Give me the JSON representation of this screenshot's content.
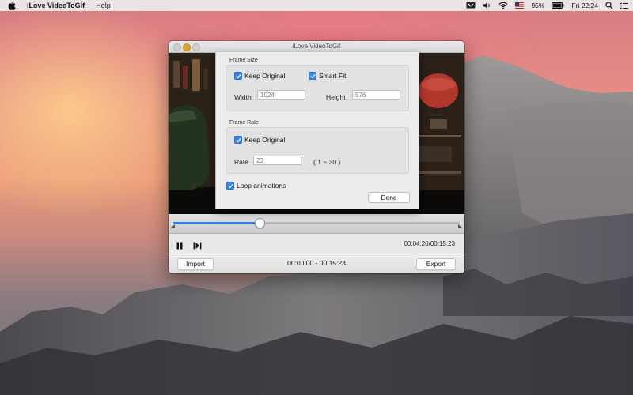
{
  "menubar": {
    "app_name": "iLove VideoToGif",
    "menu_help": "Help",
    "battery_percent": "95%",
    "clock": "Fri 22:24",
    "icons": [
      "apple-icon",
      "flag-icon",
      "volume-icon",
      "wifi-icon",
      "input-source-flag-icon",
      "battery-icon",
      "search-icon",
      "notification-center-icon"
    ]
  },
  "window": {
    "title": "iLove VideoToGif",
    "time_current_total": "00:04:20/00:15:23",
    "range": "00:00:00 - 00:15:23",
    "import_label": "Import",
    "export_label": "Export",
    "progress_fraction": 0.3,
    "accent_color": "#2f7fe6"
  },
  "settings": {
    "frame_size_title": "Frame Size",
    "keep_original_size": "Keep Original",
    "keep_original_size_checked": true,
    "smart_fit": "Smart Fit",
    "smart_fit_checked": true,
    "width_label": "Width",
    "width_value": "1024",
    "height_label": "Height",
    "height_value": "576",
    "frame_rate_title": "Frame Rate",
    "keep_original_rate": "Keep Original",
    "keep_original_rate_checked": true,
    "rate_label": "Rate",
    "rate_value": "23",
    "rate_range": "( 1 ~ 30 )",
    "loop_label": "Loop animations",
    "loop_checked": true,
    "done_label": "Done"
  }
}
